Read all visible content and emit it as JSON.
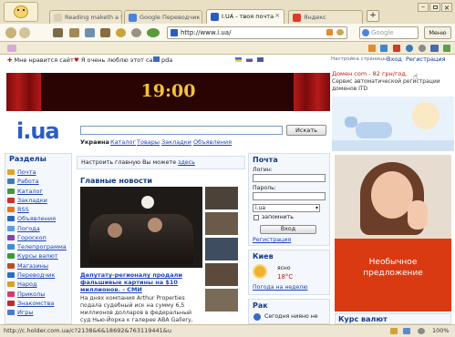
{
  "browser": {
    "tabs": [
      {
        "label": "Reading maketh a full ...",
        "active": false
      },
      {
        "label": "Google Переводчик",
        "active": false
      },
      {
        "label": "I.UA - твоя почта",
        "active": true
      },
      {
        "label": "Яндекс",
        "active": false
      }
    ],
    "new_tab": "+",
    "url": "http://www.i.ua/",
    "search_placeholder": "Google",
    "menu_label": "Меню"
  },
  "bookmarks": {
    "like": "Мне нравится сайт",
    "love": "Я очень люблю этот сайт",
    "pda": "pda",
    "settings": "Настройка страницы",
    "login": "Вход",
    "register": "Регистрация"
  },
  "page": {
    "clock": "19:00",
    "ad_top": {
      "title": "Домен com - 82 грн/год.",
      "text": "Сервис автоматической регистрации доменов ITD"
    },
    "logo": "i.ua",
    "search_button": "Искать",
    "search_tabs": [
      "Украина",
      "Каталог",
      "Товары",
      "Закладки",
      "Объявления"
    ],
    "home_prompt": "Настроить главную Вы можете",
    "home_link": "здесь",
    "sections_title": "Разделы",
    "sections": [
      "Почта",
      "Работа",
      "Каталог",
      "Закладки",
      "RSS",
      "Объявления",
      "Погода",
      "Гороскоп",
      "Телепрограмма",
      "Курсы валют",
      "Магазины",
      "Переводчик",
      "Народ",
      "Приколы",
      "Знакомства",
      "Игры"
    ],
    "section_colors": [
      "#e2a02a",
      "#3f78c8",
      "#3f9a3a",
      "#c9342c",
      "#e8761e",
      "#2f66b8",
      "#5aa0d8",
      "#8a3fb0",
      "#3a8fd0",
      "#3c9a3c",
      "#c24a20",
      "#2a6cc0",
      "#d5a12a",
      "#d93a6a",
      "#c22a2a",
      "#4a7ad0"
    ],
    "news_title": "Главные новости",
    "news_headline": "Депутату-регионалу продали фальшивые картины на $10 миллионов. - СМИ",
    "news_text": "На днях компания Arthur Properties подала судебный иск на сумму 6,5 миллионов долларов в федеральный суд Нью-Йорка к галерее ABA Gallery, которая",
    "mail_title": "Почта",
    "login_label": "Логин:",
    "password_label": "Пароль:",
    "domain_value": "i.ua",
    "remember_label": "запомнить",
    "login_button": "Вход",
    "register_link": "Регистрация",
    "weather_city": "Киев",
    "weather_desc": "ясно",
    "weather_temp": "18°C",
    "weather_week": "Погода на неделю",
    "horoscope_title": "Рак",
    "horoscope_text": "Сегодня нияно не",
    "ad_big": "Необычное предложение",
    "currency_title": "Курс валют"
  },
  "status": {
    "url": "http://c.holder.com.ua/c?2138&6&18692&763119441&u",
    "zoom": "100%"
  }
}
